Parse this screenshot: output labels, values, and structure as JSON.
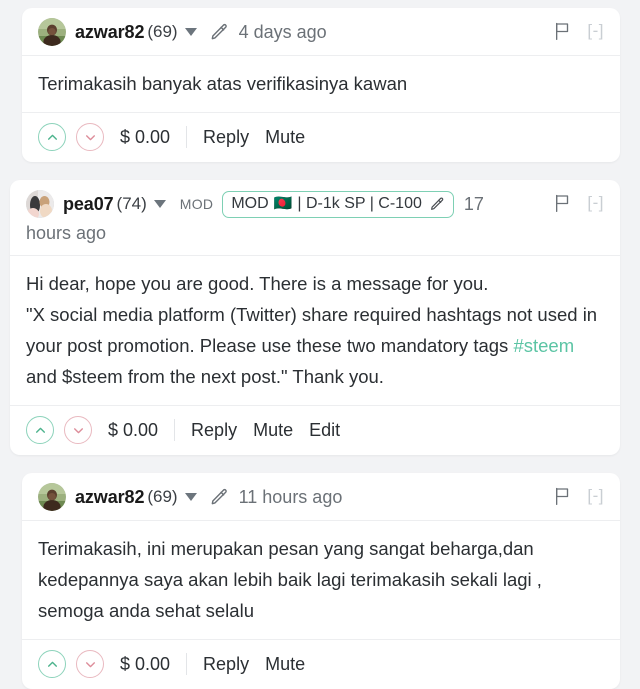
{
  "theme": {
    "page_bg": "#f2f3f5",
    "card_bg": "#ffffff",
    "upvote_color": "#8dd3bb",
    "downvote_color": "#e9b9c0",
    "tag_color": "#5bc4a4",
    "badge_border": "#7ed0b4",
    "muted_text": "#6b7177"
  },
  "comments": [
    {
      "id": "comment-1",
      "indent": true,
      "author": "azwar82",
      "reputation": "(69)",
      "mod_label": null,
      "badge": null,
      "timestamp": "4 days ago",
      "timestamp_wrap": null,
      "collapse": "[-]",
      "body_lines": [
        "Terimakasih banyak atas verifikasinya kawan"
      ],
      "payout": "$ 0.00",
      "actions": [
        "Reply",
        "Mute"
      ]
    },
    {
      "id": "comment-2",
      "indent": false,
      "author": "pea07",
      "reputation": "(74)",
      "mod_label": "MOD",
      "badge": {
        "prefix": "MOD",
        "flag": "🇧🇩",
        "text": "| D-1k SP | C-100"
      },
      "timestamp": "17",
      "timestamp_wrap": "hours ago",
      "collapse": "[-]",
      "body_lines": [
        "Hi dear, hope you are good. There is a message for you.",
        "\"X social media platform (Twitter) share required hashtags not used in your post promotion. Please use these two mandatory tags ",
        "#steem",
        " and $steem from the next post.\" Thank you."
      ],
      "payout": "$ 0.00",
      "actions": [
        "Reply",
        "Mute",
        "Edit"
      ]
    },
    {
      "id": "comment-3",
      "indent": true,
      "author": "azwar82",
      "reputation": "(69)",
      "mod_label": null,
      "badge": null,
      "timestamp": "11 hours ago",
      "timestamp_wrap": null,
      "collapse": "[-]",
      "body_lines": [
        "Terimakasih, ini merupakan pesan yang sangat beharga,dan kedepannya saya akan lebih baik lagi terimakasih sekali lagi , semoga anda sehat selalu"
      ],
      "payout": "$ 0.00",
      "actions": [
        "Reply",
        "Mute"
      ]
    }
  ],
  "icons": {
    "pencil": "pencil-icon",
    "flag": "flag-icon",
    "caret": "chevron-down-icon",
    "upvote": "upvote-chevron-icon",
    "downvote": "downvote-chevron-icon"
  }
}
